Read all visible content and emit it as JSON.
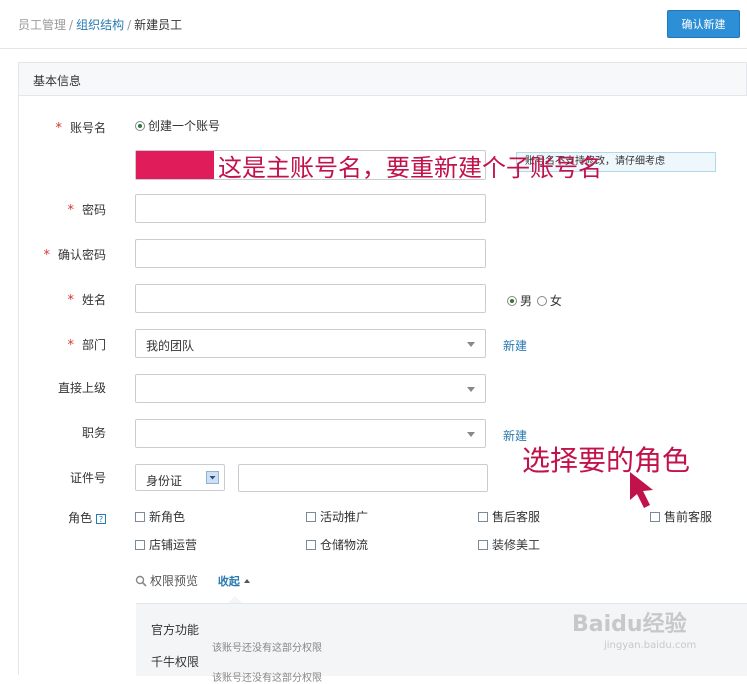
{
  "breadcrumb": {
    "item1": "员工管理",
    "sep": "/",
    "item2": "组织结构",
    "item3": "新建员工"
  },
  "header": {
    "confirm_label": "确认新建"
  },
  "section": {
    "title": "基本信息"
  },
  "form": {
    "required_mark": "*",
    "account": {
      "label": "账号名",
      "radio_label": "创建一个账号",
      "hint": "账号名不支持修改，请仔细考虑"
    },
    "password": {
      "label": "密码"
    },
    "confirm_password": {
      "label": "确认密码"
    },
    "name": {
      "label": "姓名",
      "gender_male": "男",
      "gender_female": "女"
    },
    "department": {
      "label": "部门",
      "value": "我的团队",
      "new_link": "新建"
    },
    "supervisor": {
      "label": "直接上级",
      "value": ""
    },
    "position": {
      "label": "职务",
      "value": "",
      "new_link": "新建"
    },
    "id_number": {
      "label": "证件号",
      "type_value": "身份证",
      "value": ""
    },
    "role": {
      "label": "角色",
      "help_icon": "?",
      "options": [
        "新角色",
        "活动推广",
        "售后客服",
        "售前客服",
        "店铺运营",
        "仓储物流",
        "装修美工"
      ]
    },
    "permission": {
      "label": "权限预览",
      "toggle": "收起"
    }
  },
  "preview": {
    "rows": [
      {
        "title": "官方功能",
        "desc": "该账号还没有这部分权限"
      },
      {
        "title": "千牛权限",
        "desc": "该账号还没有这部分权限"
      }
    ]
  },
  "annotations": {
    "account_note": "这是主账号名，要重新建个子账号名",
    "role_note": "选择要的角色"
  },
  "watermark": {
    "logo": "Baidu经验",
    "url": "jingyan.baidu.com"
  },
  "colors": {
    "accent": "#2d8fd6",
    "required": "#d9342c",
    "annotation": "#c2124b",
    "redaction": "#e01d5a"
  }
}
